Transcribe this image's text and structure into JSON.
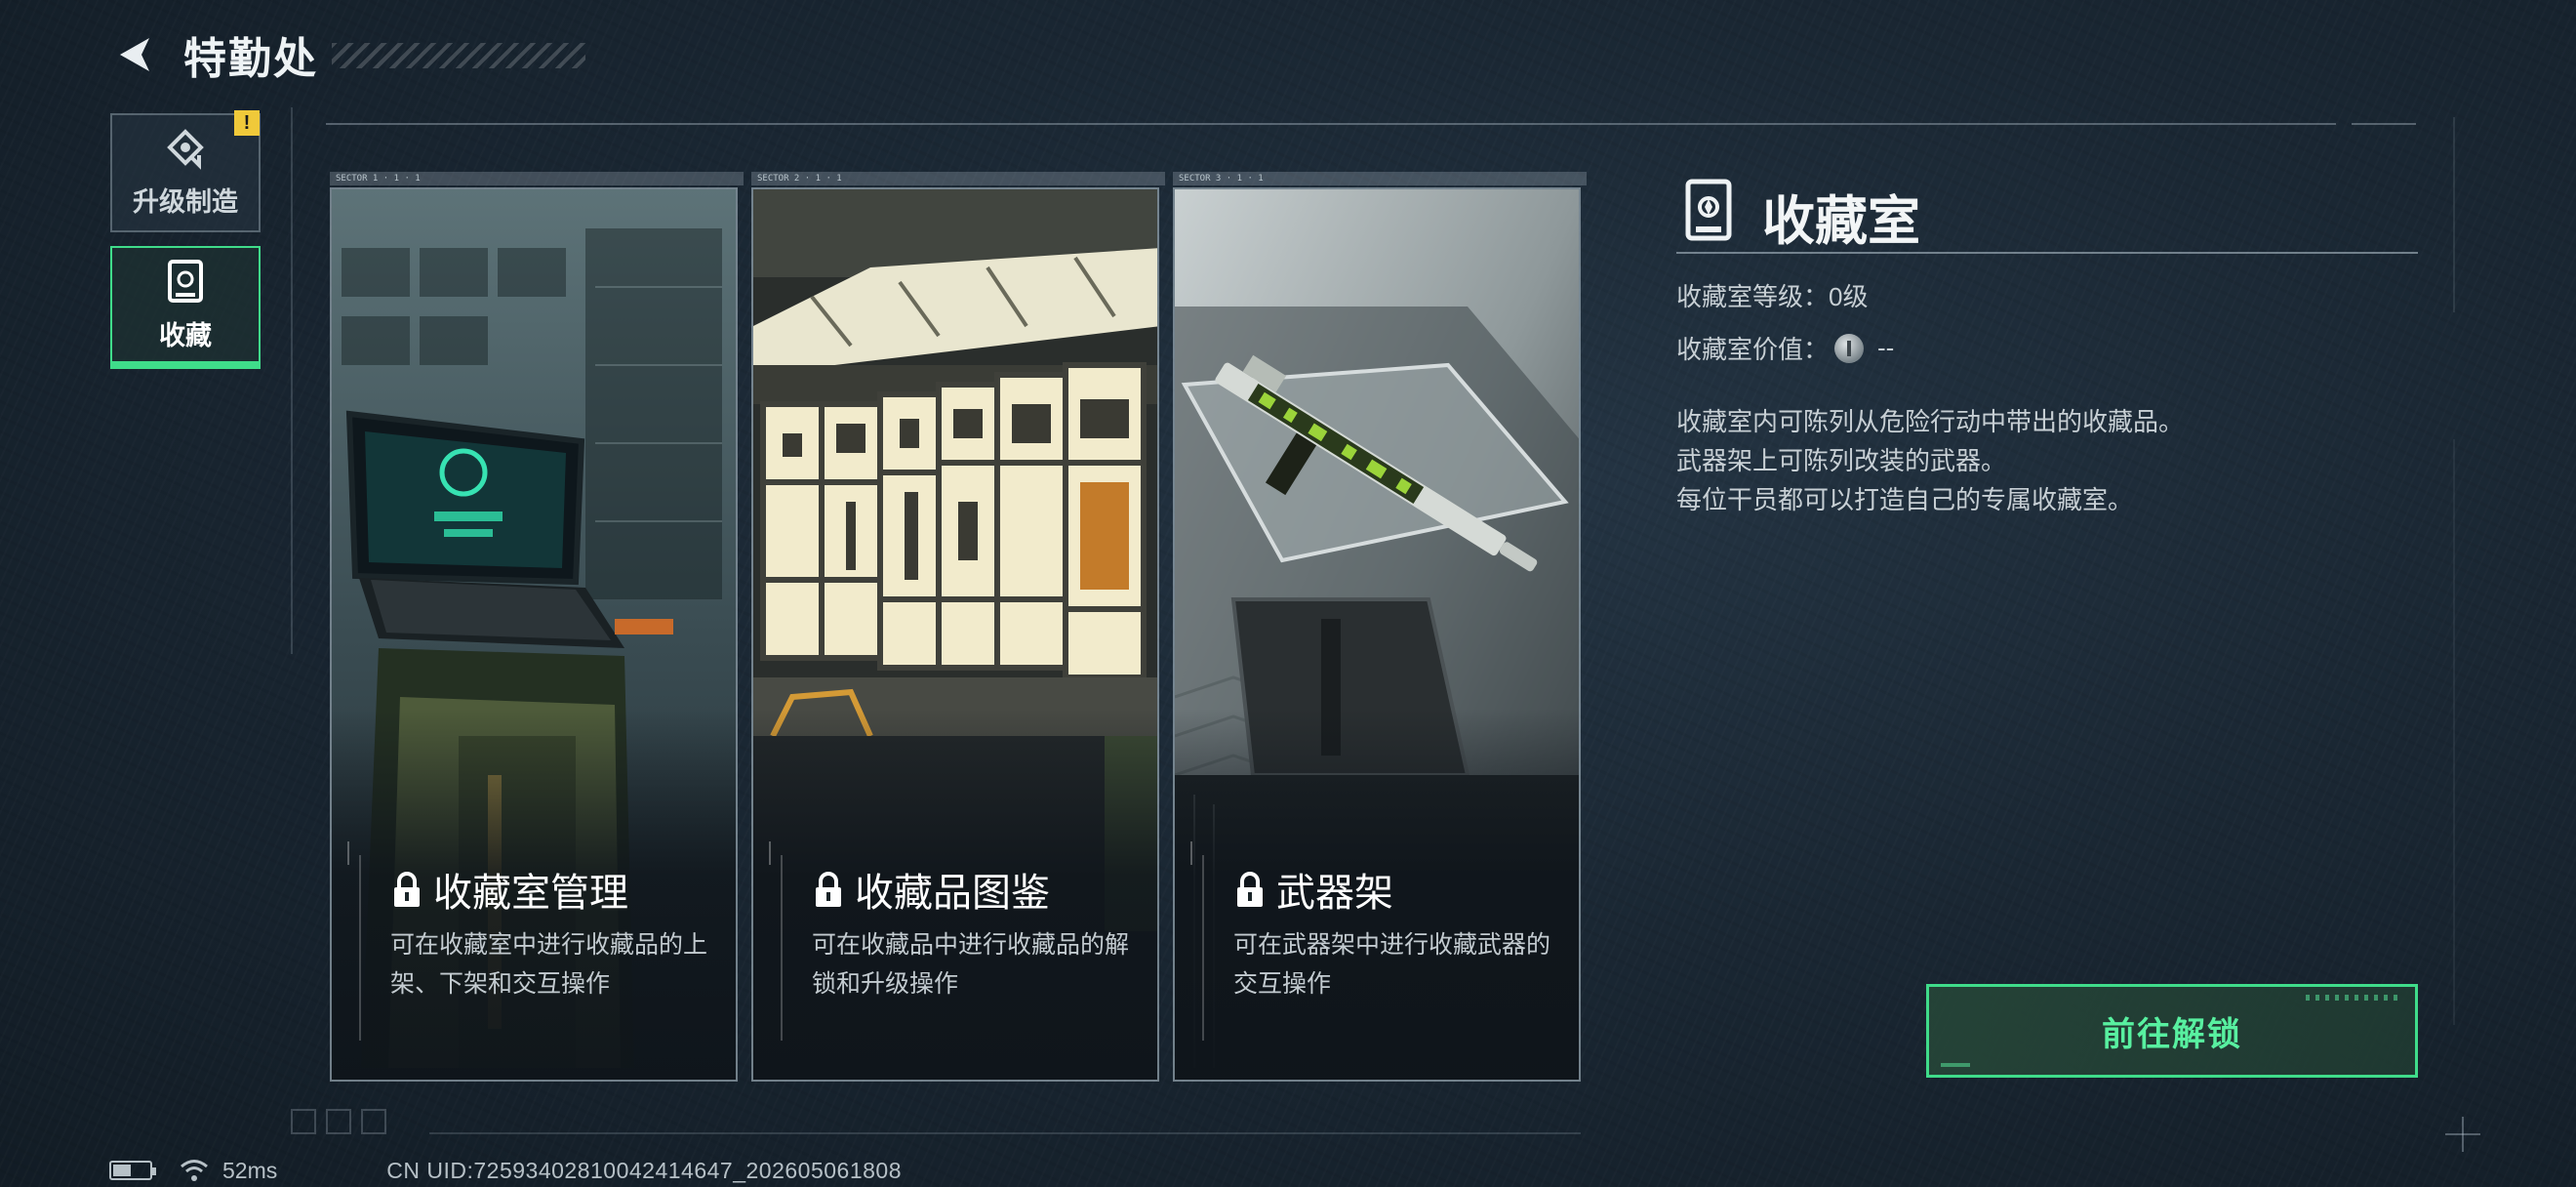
{
  "header": {
    "title": "特勤处"
  },
  "sidebar": {
    "items": [
      {
        "label": "升级制造",
        "icon": "upgrade-craft-icon",
        "active": false,
        "alert": "!"
      },
      {
        "label": "收藏",
        "icon": "collection-room-icon",
        "active": true
      }
    ]
  },
  "cards": [
    {
      "title": "收藏室管理",
      "desc": "可在收藏室中进行收藏品的上架、下架和交互操作",
      "tag": "SECTOR 1 · 1 · 1",
      "locked": true
    },
    {
      "title": "收藏品图鉴",
      "desc": "可在收藏品中进行收藏品的解锁和升级操作",
      "tag": "SECTOR 2 · 1 · 1",
      "locked": true
    },
    {
      "title": "武器架",
      "desc": "可在武器架中进行收藏武器的交互操作",
      "tag": "SECTOR 3 · 1 · 1",
      "locked": true
    }
  ],
  "panel": {
    "title": "收藏室",
    "level_label": "收藏室等级：",
    "level_value": "0级",
    "value_label": "收藏室价值：",
    "value_value": "--",
    "description": [
      "收藏室内可陈列从危险行动中带出的收藏品。",
      "武器架上可陈列改装的武器。",
      "每位干员都可以打造自己的专属收藏室。"
    ]
  },
  "unlock_button": {
    "label": "前往解锁"
  },
  "status": {
    "ping": "52ms",
    "uid": "CN UID:7259340281004241464​7_202605061808"
  },
  "colors": {
    "accent": "#3fdc8a",
    "alert": "#f0c93a",
    "background": "#1a2733"
  }
}
